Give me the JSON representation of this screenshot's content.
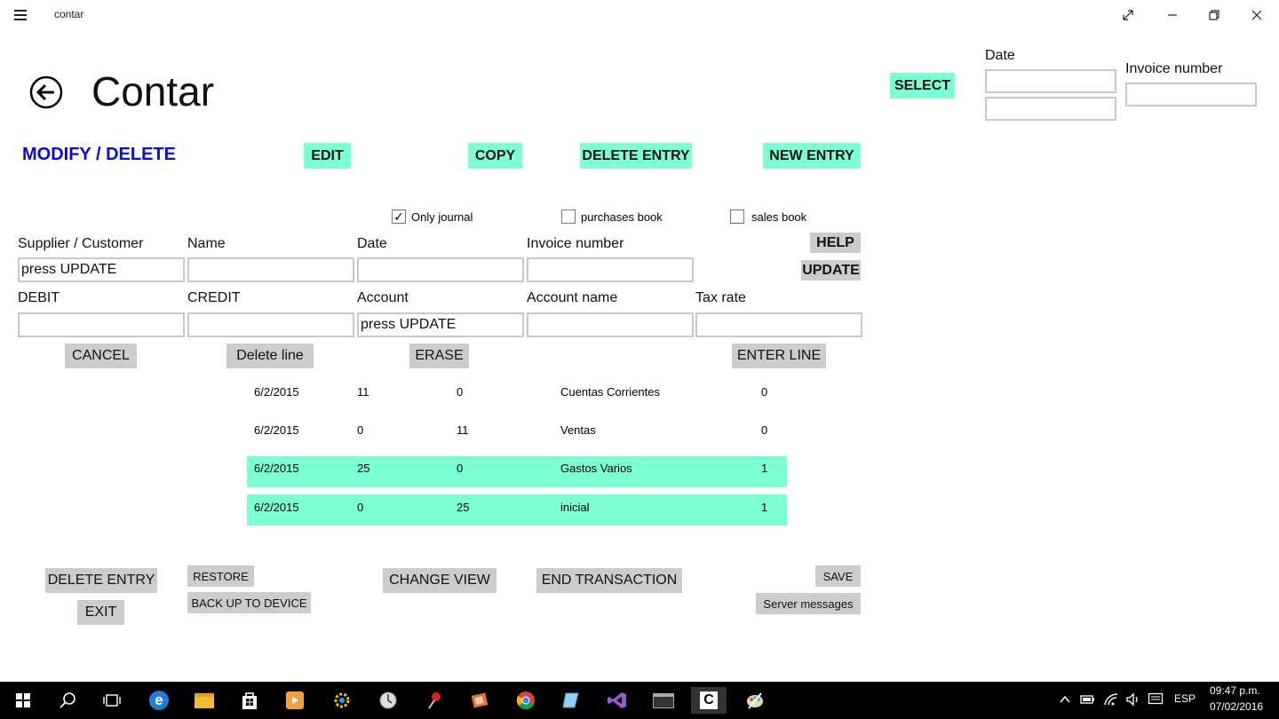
{
  "window": {
    "title": "contar"
  },
  "page": {
    "title": "Contar",
    "section": "MODIFY / DELETE"
  },
  "top_right": {
    "select_label": "SELECT",
    "date_label": "Date",
    "invoice_label": "Invoice number",
    "date_from": "",
    "date_to": "",
    "invoice_value": ""
  },
  "toolbar": {
    "edit": "EDIT",
    "copy": "COPY",
    "delete_entry": "DELETE ENTRY",
    "new_entry": "NEW ENTRY"
  },
  "filters": [
    {
      "label": "Only journal",
      "checked": true
    },
    {
      "label": "purchases book",
      "checked": false
    },
    {
      "label": "sales book",
      "checked": false
    }
  ],
  "form": {
    "supplier_label": "Supplier / Customer",
    "supplier_value": "press UPDATE",
    "name_label": "Name",
    "name_value": "",
    "date_label": "Date",
    "date_value": "",
    "invoice_label": "Invoice number",
    "invoice_value": "",
    "debit_label": "DEBIT",
    "debit_value": "",
    "credit_label": "CREDIT",
    "credit_value": "",
    "account_label": "Account",
    "account_value": "press UPDATE",
    "account_name_label": "Account name",
    "account_name_value": "",
    "tax_label": "Tax rate",
    "tax_value": "",
    "help": "HELP",
    "update": "UPDATE"
  },
  "line_actions": {
    "cancel": "CANCEL",
    "delete_line": "Delete line",
    "erase": "ERASE",
    "enter_line": "ENTER LINE"
  },
  "entries": [
    {
      "date": "6/2/2015",
      "debit": "11",
      "credit": "0",
      "account": "Cuentas Corrientes",
      "tax": "0",
      "highlighted": false
    },
    {
      "date": "6/2/2015",
      "debit": "0",
      "credit": "11",
      "account": "Ventas",
      "tax": "0",
      "highlighted": false
    },
    {
      "date": "6/2/2015",
      "debit": "25",
      "credit": "0",
      "account": "Gastos Varios",
      "tax": "1",
      "highlighted": true
    },
    {
      "date": "6/2/2015",
      "debit": "0",
      "credit": "25",
      "account": "inicial",
      "tax": "1",
      "highlighted": true
    }
  ],
  "bottom": {
    "delete_entry": "DELETE ENTRY",
    "exit": "EXIT",
    "restore": "RESTORE",
    "backup": "BACK UP TO DEVICE",
    "change_view": "CHANGE VIEW",
    "end_transaction": "END TRANSACTION",
    "save": "SAVE",
    "server_messages": "Server messages"
  },
  "taskbar": {
    "icons": [
      "start-icon",
      "search-icon",
      "task-view-icon",
      "edge-icon",
      "file-explorer-icon",
      "store-icon",
      "media-player-icon",
      "settings-tool-icon",
      "clock-app-icon",
      "pin-app-icon",
      "paint-app-icon",
      "chrome-icon",
      "notepad-icon",
      "visual-studio-icon",
      "terminal-icon",
      "contar-app-icon",
      "art-app-icon"
    ],
    "language": "ESP",
    "time": "09:47 p.m.",
    "date": "07/02/2016"
  },
  "colors": {
    "accent_green": "#7dffd5",
    "section_blue": "#0a0ad6",
    "button_gray": "#cccccc"
  }
}
